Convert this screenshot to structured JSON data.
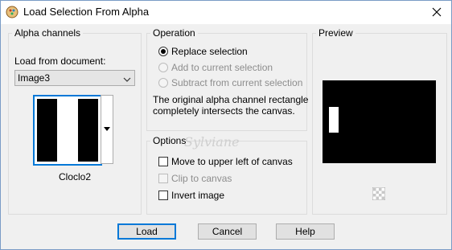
{
  "window": {
    "title": "Load Selection From Alpha",
    "close_icon": "close-icon"
  },
  "alpha_channels": {
    "legend": "Alpha channels",
    "load_from_label": "Load from document:",
    "document_value": "Image3",
    "channel_name": "Cloclo2"
  },
  "operation": {
    "legend": "Operation",
    "options": [
      {
        "label": "Replace selection",
        "selected": true,
        "enabled": true
      },
      {
        "label": "Add to current selection",
        "selected": false,
        "enabled": false
      },
      {
        "label": "Subtract from current selection",
        "selected": false,
        "enabled": false
      }
    ],
    "message_line1": "The original alpha channel rectangle",
    "message_line2": "completely intersects the canvas."
  },
  "options": {
    "legend": "Options",
    "items": [
      {
        "label": "Move to upper left of canvas",
        "checked": false,
        "enabled": true
      },
      {
        "label": "Clip to canvas",
        "checked": false,
        "enabled": false
      },
      {
        "label": "Invert image",
        "checked": false,
        "enabled": true
      }
    ]
  },
  "preview": {
    "legend": "Preview"
  },
  "buttons": {
    "load": "Load",
    "cancel": "Cancel",
    "help": "Help"
  },
  "watermark": "Sylviane",
  "colors": {
    "accent": "#0078d7",
    "window_bg": "#f0f0f0",
    "disabled_text": "#8d8d8d"
  }
}
